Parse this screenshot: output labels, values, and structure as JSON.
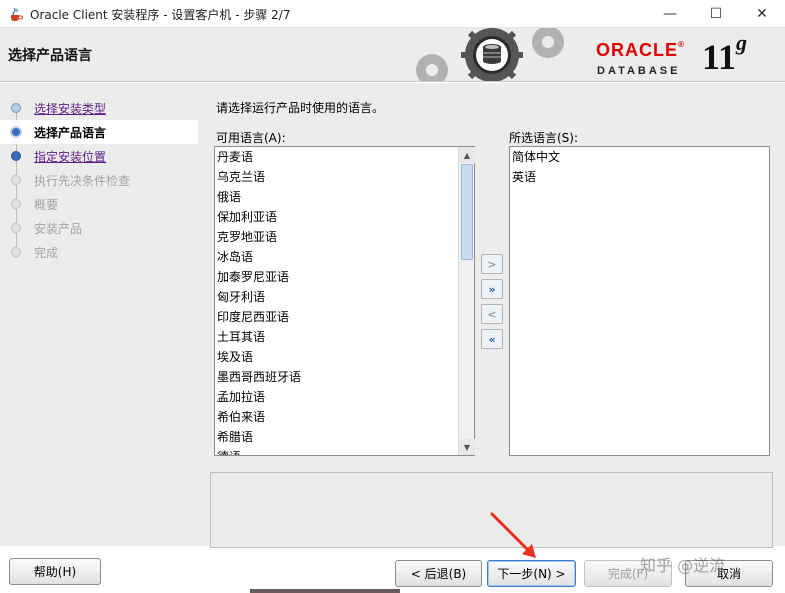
{
  "window": {
    "title": "Oracle Client 安装程序 - 设置客户机 - 步骤 2/7",
    "min_glyph": "—",
    "max_glyph": "☐",
    "close_glyph": "✕"
  },
  "banner": {
    "title": "选择产品语言",
    "logo_oracle": "ORACLE",
    "logo_registered": "®",
    "logo_database": "DATABASE",
    "version_number": "11",
    "version_suffix": "g"
  },
  "steps": [
    {
      "label": "选择安装类型",
      "state": "done"
    },
    {
      "label": "选择产品语言",
      "state": "current"
    },
    {
      "label": "指定安装位置",
      "state": "next"
    },
    {
      "label": "执行先决条件检查",
      "state": "disabled"
    },
    {
      "label": "概要",
      "state": "disabled"
    },
    {
      "label": "安装产品",
      "state": "disabled"
    },
    {
      "label": "完成",
      "state": "disabled"
    }
  ],
  "main": {
    "prompt": "请选择运行产品时使用的语言。",
    "available_label": "可用语言(A):",
    "selected_label": "所选语言(S):",
    "available_languages": [
      "丹麦语",
      "乌克兰语",
      "俄语",
      "保加利亚语",
      "克罗地亚语",
      "冰岛语",
      "加泰罗尼亚语",
      "匈牙利语",
      "印度尼西亚语",
      "土耳其语",
      "埃及语",
      "墨西哥西班牙语",
      "孟加拉语",
      "希伯来语",
      "希腊语",
      "德语"
    ],
    "selected_languages": [
      "简体中文",
      "英语"
    ],
    "move_buttons": {
      "add": ">",
      "add_all": "»",
      "remove": "<",
      "remove_all": "«"
    },
    "scroll_up": "▲",
    "scroll_down": "▼"
  },
  "buttons": {
    "help": "帮助(H)",
    "back": "< 后退(B)",
    "next": "下一步(N) >",
    "finish": "完成(F)",
    "cancel": "取消"
  },
  "watermark": "知乎 @逆流",
  "colors": {
    "oracle_red": "#e00000",
    "link_purple": "#5b1d87",
    "accent_blue": "#3a6fbf",
    "arrow_red": "#e8321e"
  }
}
